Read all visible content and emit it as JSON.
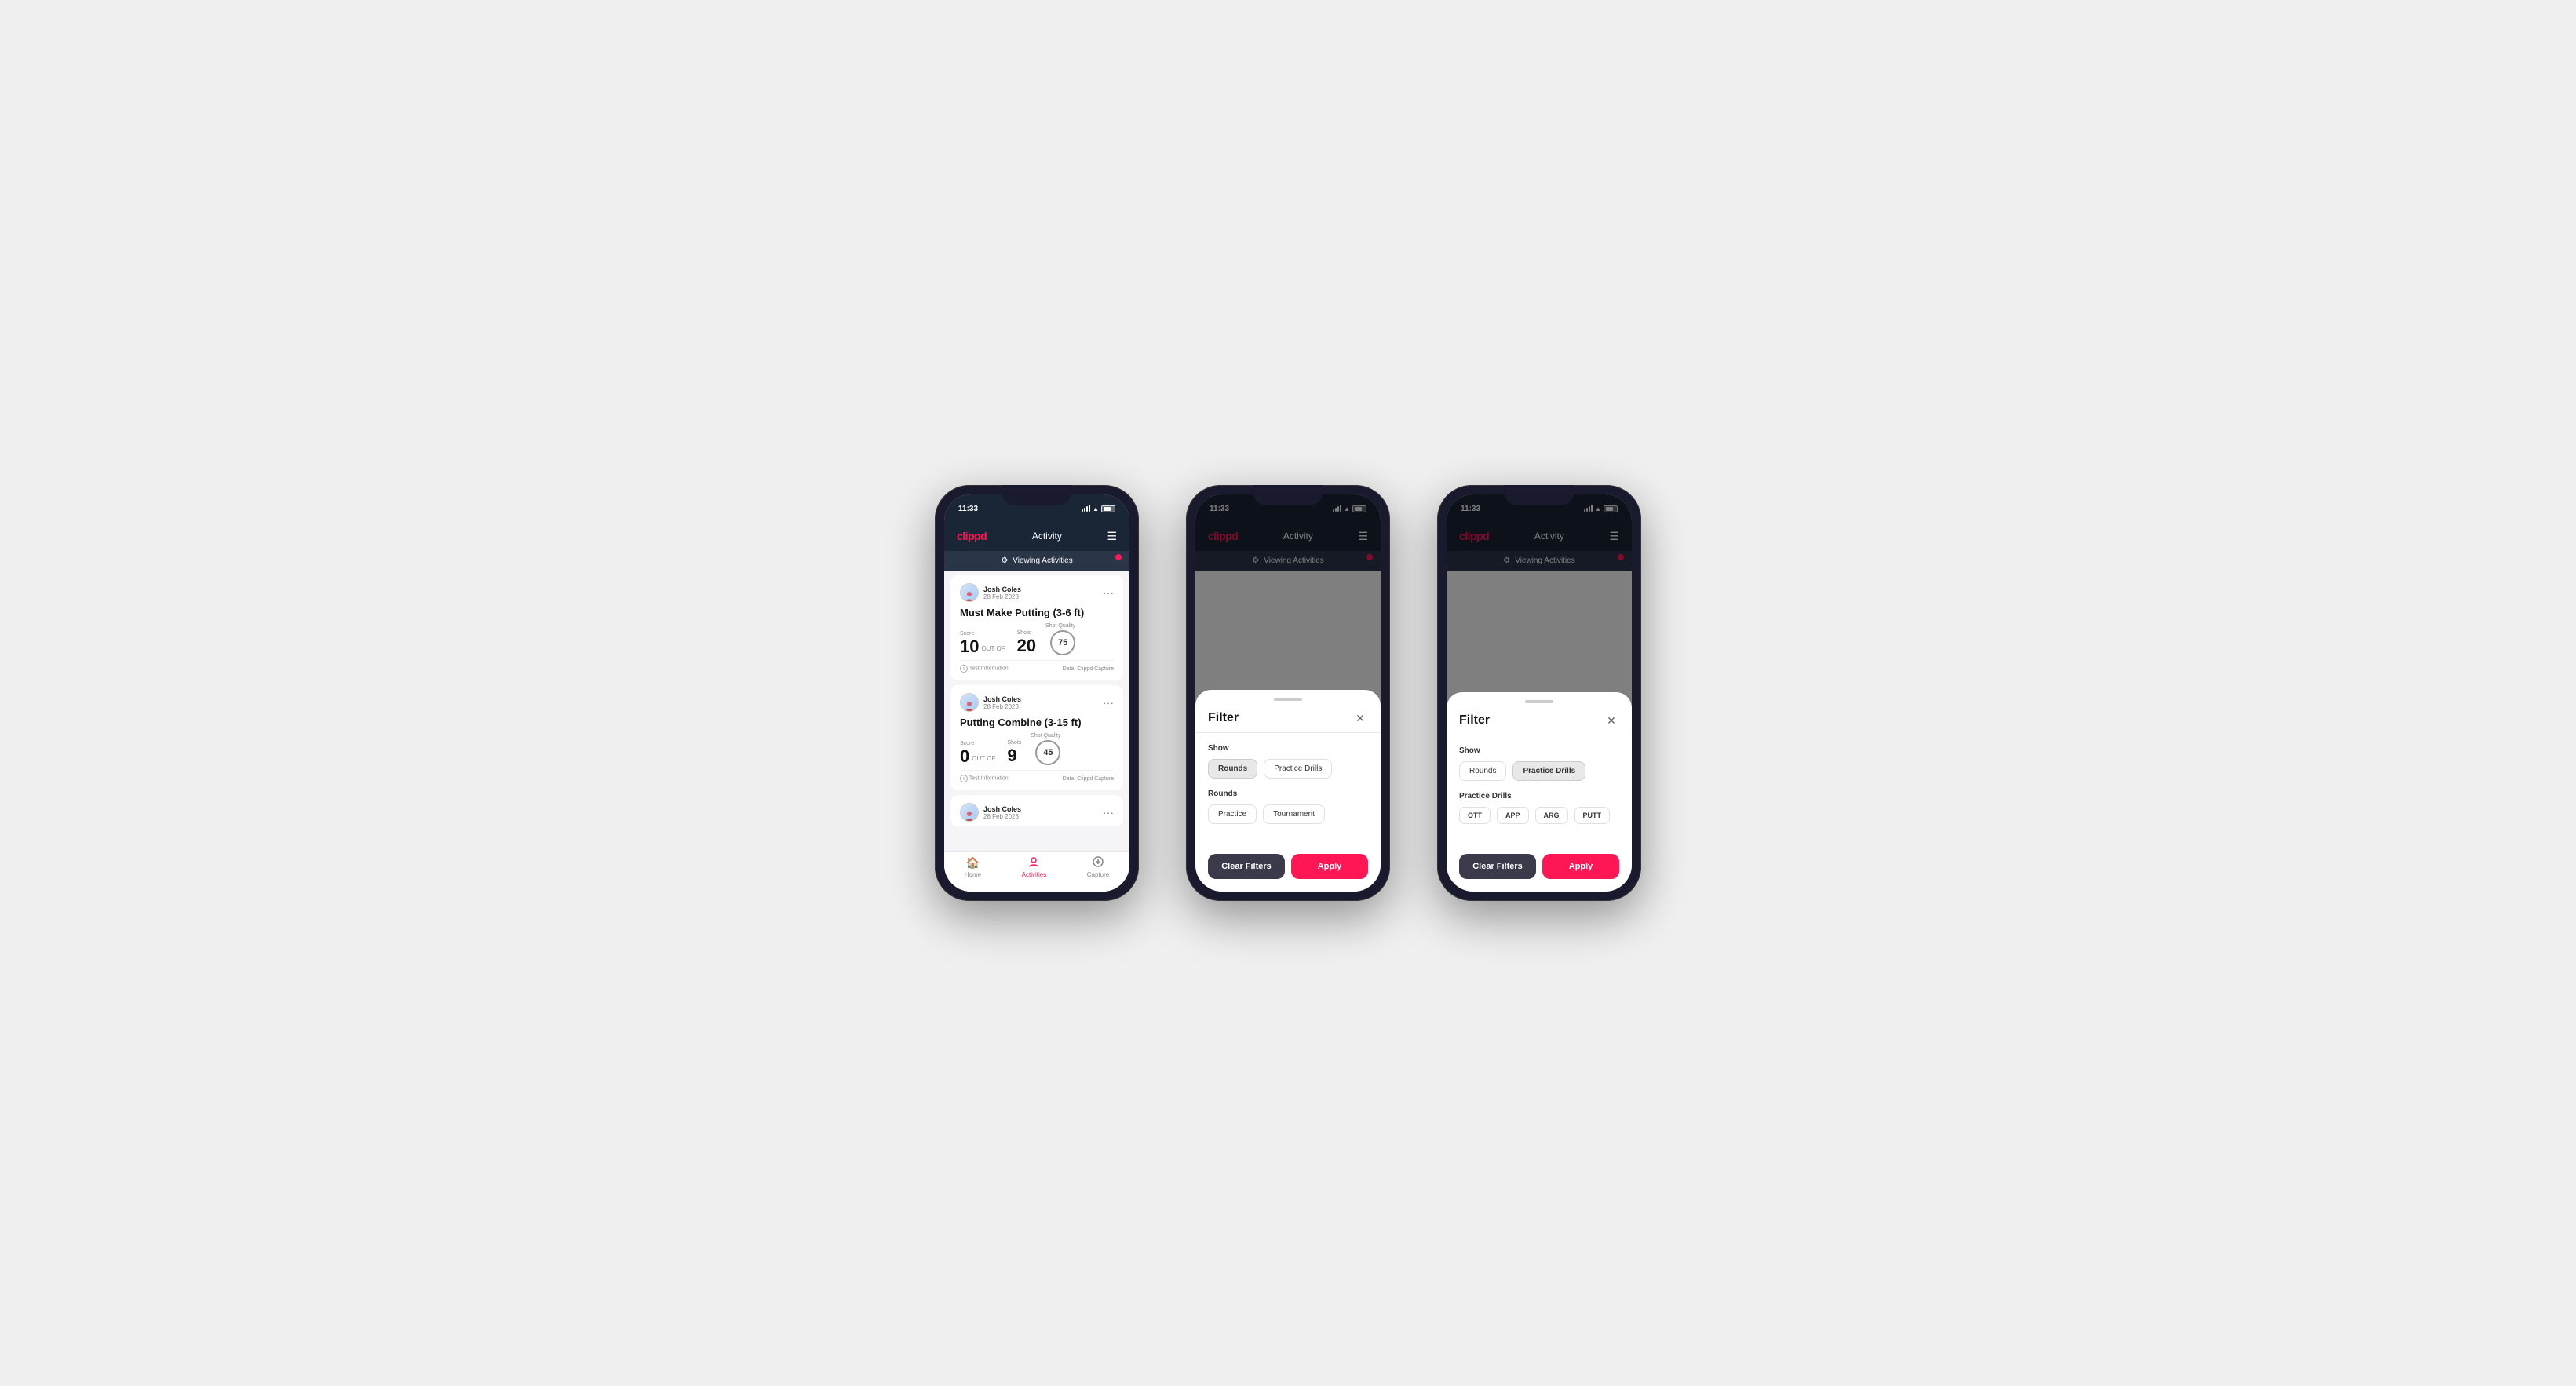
{
  "app": {
    "logo": "clippd",
    "title": "Activity",
    "time": "11:33"
  },
  "phone1": {
    "banner": "Viewing Activities",
    "cards": [
      {
        "user": "Josh Coles",
        "date": "28 Feb 2023",
        "title": "Must Make Putting (3-6 ft)",
        "score_label": "Score",
        "score": "10",
        "out_of": "OUT OF",
        "shots_label": "Shots",
        "shots": "20",
        "shot_quality_label": "Shot Quality",
        "shot_quality": "75",
        "info": "Test Information",
        "data": "Data: Clippd Capture"
      },
      {
        "user": "Josh Coles",
        "date": "28 Feb 2023",
        "title": "Putting Combine (3-15 ft)",
        "score_label": "Score",
        "score": "0",
        "out_of": "OUT OF",
        "shots_label": "Shots",
        "shots": "9",
        "shot_quality_label": "Shot Quality",
        "shot_quality": "45",
        "info": "Test Information",
        "data": "Data: Clippd Capture"
      },
      {
        "user": "Josh Coles",
        "date": "28 Feb 2023",
        "title": "",
        "score_label": "",
        "score": "",
        "out_of": "",
        "shots_label": "",
        "shots": "",
        "shot_quality_label": "",
        "shot_quality": "",
        "info": "",
        "data": ""
      }
    ],
    "tabs": [
      {
        "label": "Home",
        "icon": "🏠",
        "active": false
      },
      {
        "label": "Activities",
        "icon": "👤",
        "active": true
      },
      {
        "label": "Capture",
        "icon": "➕",
        "active": false
      }
    ]
  },
  "phone2": {
    "banner": "Viewing Activities",
    "filter": {
      "title": "Filter",
      "show_label": "Show",
      "show_buttons": [
        {
          "label": "Rounds",
          "active": true
        },
        {
          "label": "Practice Drills",
          "active": false
        }
      ],
      "rounds_label": "Rounds",
      "rounds_buttons": [
        {
          "label": "Practice",
          "active": false
        },
        {
          "label": "Tournament",
          "active": false
        }
      ],
      "clear_label": "Clear Filters",
      "apply_label": "Apply"
    }
  },
  "phone3": {
    "banner": "Viewing Activities",
    "filter": {
      "title": "Filter",
      "show_label": "Show",
      "show_buttons": [
        {
          "label": "Rounds",
          "active": false
        },
        {
          "label": "Practice Drills",
          "active": true
        }
      ],
      "practice_drills_label": "Practice Drills",
      "drill_tags": [
        {
          "label": "OTT",
          "active": false
        },
        {
          "label": "APP",
          "active": false
        },
        {
          "label": "ARG",
          "active": false
        },
        {
          "label": "PUTT",
          "active": false
        }
      ],
      "clear_label": "Clear Filters",
      "apply_label": "Apply"
    }
  }
}
